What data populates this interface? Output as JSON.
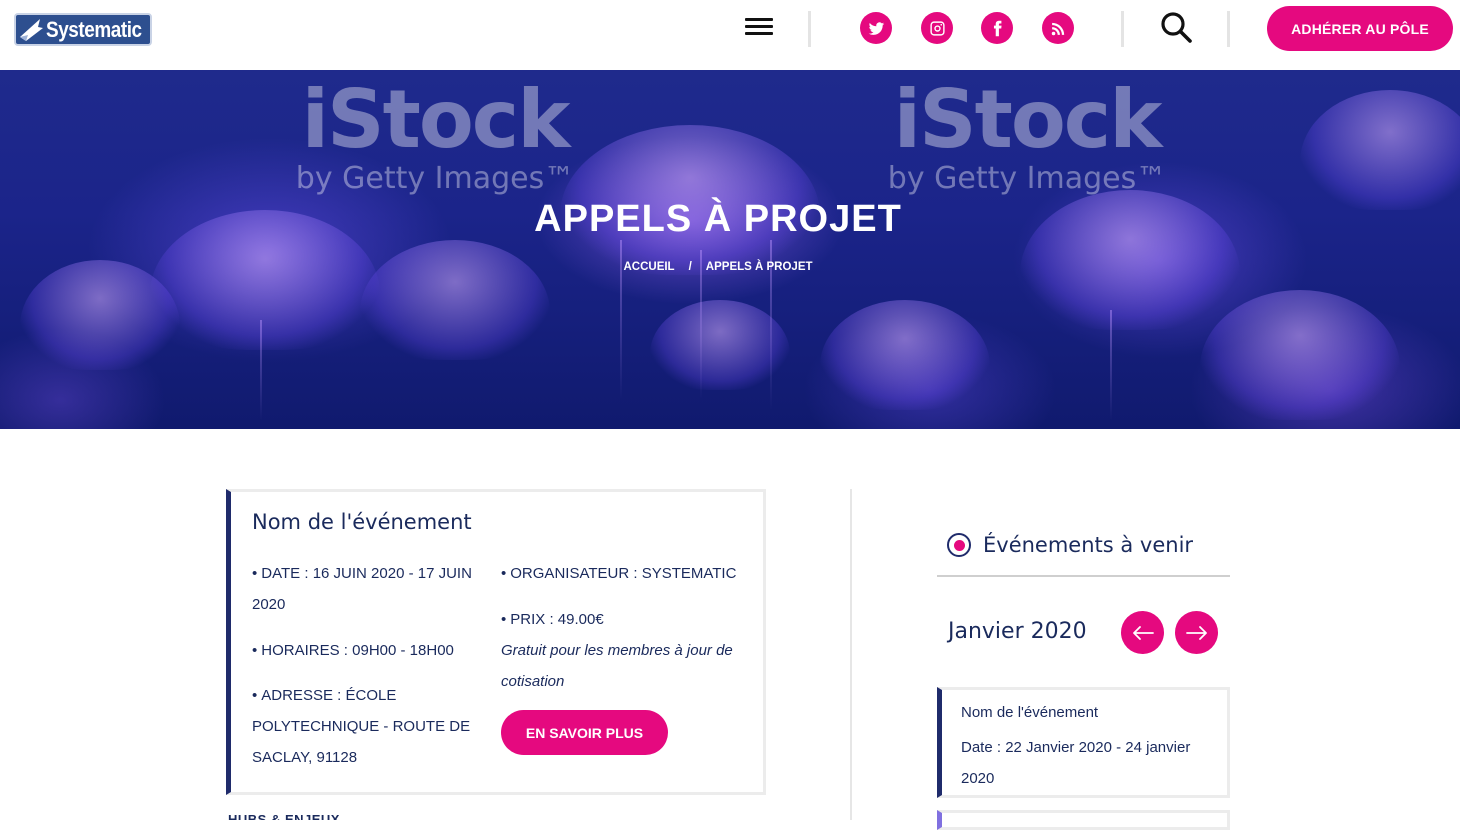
{
  "header": {
    "logo_text": "Systematic",
    "cta_label": "ADHÉRER AU PÔLE",
    "social_icons": [
      "twitter-icon",
      "instagram-icon",
      "facebook-icon",
      "rss-icon"
    ],
    "accent_color": "#e5097f"
  },
  "hero": {
    "title": "APPELS À PROJET",
    "watermark_big": "iStock",
    "watermark_small": "by Getty Images™",
    "breadcrumb": [
      "ACCUEIL",
      "/",
      "APPELS À PROJET"
    ]
  },
  "event": {
    "title": "Nom de l'événement",
    "date_label": "DATE",
    "date_value": "16 JUIN 2020 - 17 JUIN 2020",
    "hours_label": "HORAIRES",
    "hours_value": "09H00 - 18H00",
    "address_label": "ADRESSE",
    "address_value": "ÉCOLE POLYTECHNIQUE - ROUTE DE SACLAY, 91128",
    "organizer_label": "ORGANISATEUR",
    "organizer_value": "SYSTEMATIC",
    "price_label": "PRIX",
    "price_value": "49.00€",
    "price_note": "Gratuit pour les membres à jour de cotisation",
    "more_button": "EN SAVOIR PLUS",
    "below_text": "HUBS & ENJEUX"
  },
  "sidebar": {
    "title": "Événements à venir",
    "month": "Janvier 2020",
    "upcoming": [
      {
        "title": "Nom de l'événement",
        "date_label": "Date",
        "date_value": "22 Janvier 2020 - 24 janvier 2020"
      }
    ]
  }
}
